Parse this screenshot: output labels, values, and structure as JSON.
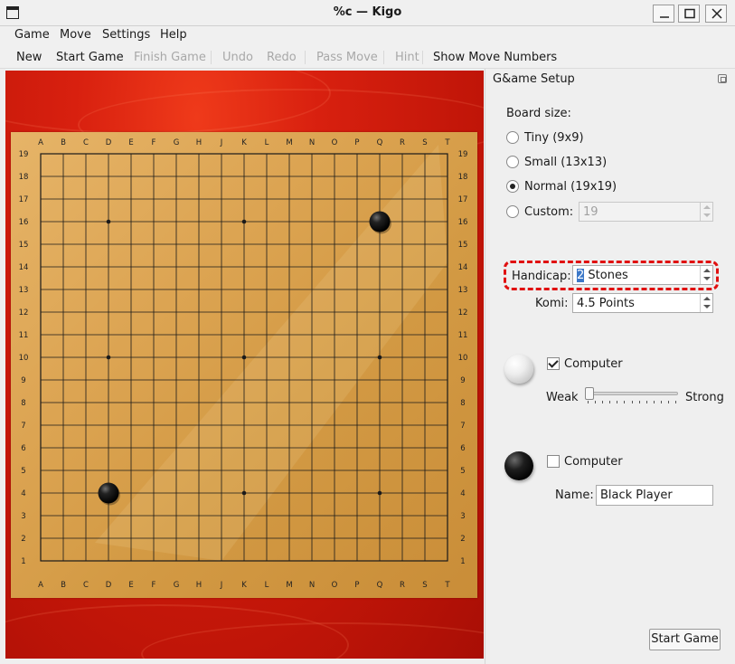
{
  "window": {
    "title": "%c — Kigo",
    "controls": [
      "minimize",
      "maximize",
      "close"
    ]
  },
  "menubar": {
    "items": [
      {
        "label": "Game",
        "mnemonic": "G"
      },
      {
        "label": "Move",
        "mnemonic": "M"
      },
      {
        "label": "Settings",
        "mnemonic": "S"
      },
      {
        "label": "Help",
        "mnemonic": "H"
      }
    ]
  },
  "toolbar": {
    "new": "New",
    "start_game": "Start Game",
    "finish_game": "Finish Game",
    "undo": "Undo",
    "redo": "Redo",
    "pass_move": "Pass Move",
    "hint": "Hint",
    "show_move_numbers": "Show Move Numbers"
  },
  "board": {
    "columns": [
      "A",
      "B",
      "C",
      "D",
      "E",
      "F",
      "G",
      "H",
      "J",
      "K",
      "L",
      "M",
      "N",
      "O",
      "P",
      "Q",
      "R",
      "S",
      "T"
    ],
    "rows": [
      "19",
      "18",
      "17",
      "16",
      "15",
      "14",
      "13",
      "12",
      "11",
      "10",
      "9",
      "8",
      "7",
      "6",
      "5",
      "4",
      "3",
      "2",
      "1"
    ],
    "stones": [
      {
        "color": "black",
        "coord": "Q16"
      },
      {
        "color": "black",
        "coord": "D4"
      }
    ],
    "star_points": [
      "D16",
      "K16",
      "Q16",
      "D10",
      "K10",
      "Q10",
      "D4",
      "K4",
      "Q4"
    ]
  },
  "setup": {
    "title": "G&ame Setup",
    "board_size_label": "Board size:",
    "sizes": [
      {
        "label": "Tiny (9x9)",
        "checked": false
      },
      {
        "label": "Small (13x13)",
        "checked": false
      },
      {
        "label": "Normal (19x19)",
        "checked": true
      },
      {
        "label": "Custom:",
        "checked": false
      }
    ],
    "custom_value": "19",
    "handicap_label": "Handicap:",
    "handicap_value_sel": "2",
    "handicap_value_rest": " Stones",
    "komi_label": "Komi:",
    "komi_value": "4.5 Points",
    "white": {
      "computer_label": "Computer",
      "computer_checked": true,
      "weak_label": "Weak",
      "strong_label": "Strong",
      "strength": 0.0
    },
    "black": {
      "computer_label": "Computer",
      "computer_checked": false,
      "name_label": "Name:",
      "name_value": "Black Player"
    },
    "start_button": "Start Game"
  }
}
